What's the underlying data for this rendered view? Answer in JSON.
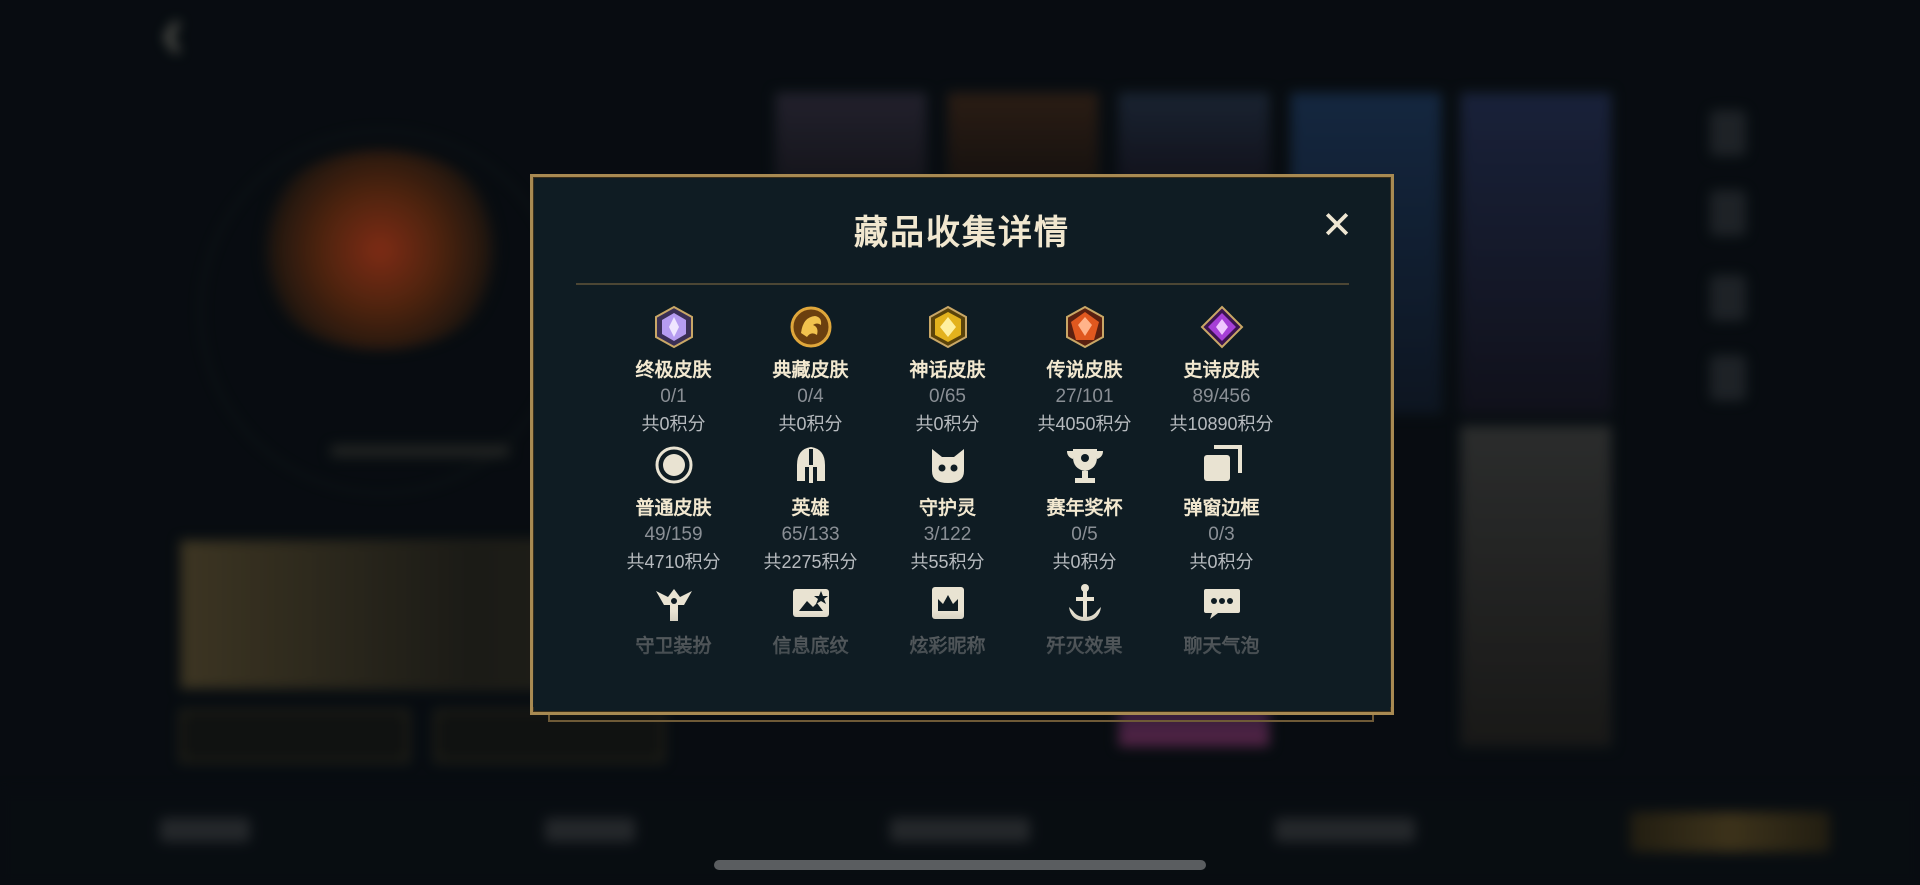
{
  "modal": {
    "title": "藏品收集详情",
    "close_glyph": "✕"
  },
  "categories": [
    {
      "label": "终极皮肤",
      "count": "0/1",
      "points": "共0积分",
      "icon": "ultimate-gem-icon",
      "color": "#b69cf0"
    },
    {
      "label": "典藏皮肤",
      "count": "0/4",
      "points": "共0积分",
      "icon": "dragon-emblem-icon",
      "color": "#d9962a"
    },
    {
      "label": "神话皮肤",
      "count": "0/65",
      "points": "共0积分",
      "icon": "mythic-gem-icon",
      "color": "#e3b21d"
    },
    {
      "label": "传说皮肤",
      "count": "27/101",
      "points": "共4050积分",
      "icon": "legend-gem-icon",
      "color": "#e0581f"
    },
    {
      "label": "史诗皮肤",
      "count": "89/456",
      "points": "共10890积分",
      "icon": "epic-gem-icon",
      "color": "#a63fd6"
    },
    {
      "label": "普通皮肤",
      "count": "49/159",
      "points": "共4710积分",
      "icon": "ring-icon",
      "color": "#e9e3d2"
    },
    {
      "label": "英雄",
      "count": "65/133",
      "points": "共2275积分",
      "icon": "helmet-icon",
      "color": "#e9e3d2"
    },
    {
      "label": "守护灵",
      "count": "3/122",
      "points": "共55积分",
      "icon": "spirit-pet-icon",
      "color": "#e9e3d2"
    },
    {
      "label": "赛年奖杯",
      "count": "0/5",
      "points": "共0积分",
      "icon": "trophy-icon",
      "color": "#e9e3d2"
    },
    {
      "label": "弹窗边框",
      "count": "0/3",
      "points": "共0积分",
      "icon": "frame-icon",
      "color": "#e9e3d2"
    },
    {
      "label": "守卫装扮",
      "icon": "ward-icon",
      "color": "#e9e3d2"
    },
    {
      "label": "信息底纹",
      "icon": "info-card-icon",
      "color": "#e9e3d2"
    },
    {
      "label": "炫彩昵称",
      "icon": "nameplate-crown-icon",
      "color": "#e9e3d2"
    },
    {
      "label": "歼灭效果",
      "icon": "anchor-icon",
      "color": "#e9e3d2"
    },
    {
      "label": "聊天气泡",
      "icon": "chat-bubble-icon",
      "color": "#e9e3d2"
    }
  ]
}
